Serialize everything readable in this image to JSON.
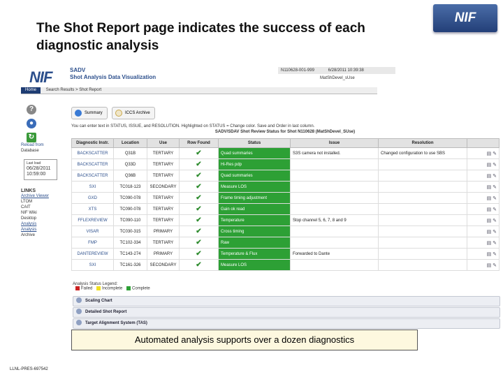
{
  "slide": {
    "title": "The Shot Report page indicates the success of each diagnostic analysis",
    "logo": "NIF",
    "caption": "Automated analysis supports over a dozen diagnostics",
    "footer_id": "LLNL-PRES-697542"
  },
  "app": {
    "logo": "NIF",
    "name_line1": "SADV",
    "name_line2": "Shot Analysis Data Visualization",
    "shot_id": "N110628-001-999",
    "shot_date": "6/28/2011 10:39:38",
    "shot_user": "MatShDevel_sUse",
    "nav": {
      "home": "Home",
      "breadcrumb": "Search Results > Shot Report"
    },
    "sidebar": {
      "reload_label": "Reload from",
      "reload_sub": "Database",
      "last_label": "Last load",
      "last_date": "06/28/2011",
      "last_time": "10:59:00",
      "links_heading": "LINKS",
      "links": [
        "Archive Viewer",
        "LTOM",
        "CAIT",
        "NIF Wiki",
        "Desktop",
        "Analysis",
        "Analysis",
        "Archive"
      ]
    },
    "tabs": [
      "Summary",
      "ICCS Archive"
    ],
    "banner": "You can enter text in STATUS, ISSUE, and RESOLUTION. Highlighted on STATUS = Change color. Save and Order in last column.",
    "table_title": "SADV/SDAV Shot Review Status for Shot N110628 (MatShDevel_SUse)",
    "columns": [
      "Diagnostic Instr.",
      "Location",
      "Use",
      "Row Found",
      "Status",
      "Issue",
      "Resolution"
    ],
    "rows": [
      {
        "diag": "BACKSCATTER",
        "loc": "Q31B",
        "use": "TERTIARY",
        "status": "Quad summaries",
        "issue": "S3S camera not installed.",
        "resolution": "Changed configuration to use SBS"
      },
      {
        "diag": "BACKSCATTER",
        "loc": "Q33D",
        "use": "TERTIARY",
        "status": "Hi-Res pdp",
        "issue": "",
        "resolution": ""
      },
      {
        "diag": "BACKSCATTER",
        "loc": "Q36B",
        "use": "TERTIARY",
        "status": "Quad summaries",
        "issue": "",
        "resolution": ""
      },
      {
        "diag": "SXI",
        "loc": "TC018-123",
        "use": "SECONDARY",
        "status": "Measure LOS",
        "issue": "",
        "resolution": ""
      },
      {
        "diag": "GXD",
        "loc": "TC090-078",
        "use": "TERTIARY",
        "status": "Frame timing adjustment",
        "issue": "",
        "resolution": ""
      },
      {
        "diag": "XTS",
        "loc": "TC090-078",
        "use": "TERTIARY",
        "status": "Gain ok read",
        "issue": "",
        "resolution": ""
      },
      {
        "diag": "FFLEXREVIEW",
        "loc": "TC090-110",
        "use": "TERTIARY",
        "status": "Temperature",
        "issue": "Stop channel 5, 6, 7, 8 and 9",
        "resolution": ""
      },
      {
        "diag": "VISAR",
        "loc": "TC030-315",
        "use": "PRIMARY",
        "status": "Cross timing",
        "issue": "",
        "resolution": ""
      },
      {
        "diag": "FMP",
        "loc": "TC102-334",
        "use": "TERTIARY",
        "status": "Raw",
        "issue": "",
        "resolution": ""
      },
      {
        "diag": "DANTEREVIEW",
        "loc": "TC143-274",
        "use": "PRIMARY",
        "status": "Temperature & Flux",
        "issue": "Forwarded to Dante",
        "resolution": ""
      },
      {
        "diag": "SXI",
        "loc": "TC161-326",
        "use": "SECONDARY",
        "status": "Measure LOS",
        "issue": "",
        "resolution": ""
      }
    ],
    "legend": {
      "label": "Analysis Status Legend:",
      "failed": "Failed",
      "incomplete": "Incomplete",
      "complete": "Complete"
    },
    "panels": [
      "Scaling Chart",
      "Detailed Shot Report",
      "Target Alignment System (TAS)"
    ],
    "colors": {
      "complete": "#2da035",
      "incomplete": "#f0e020",
      "failed": "#cc2222",
      "brand": "#2c4f8c"
    }
  }
}
